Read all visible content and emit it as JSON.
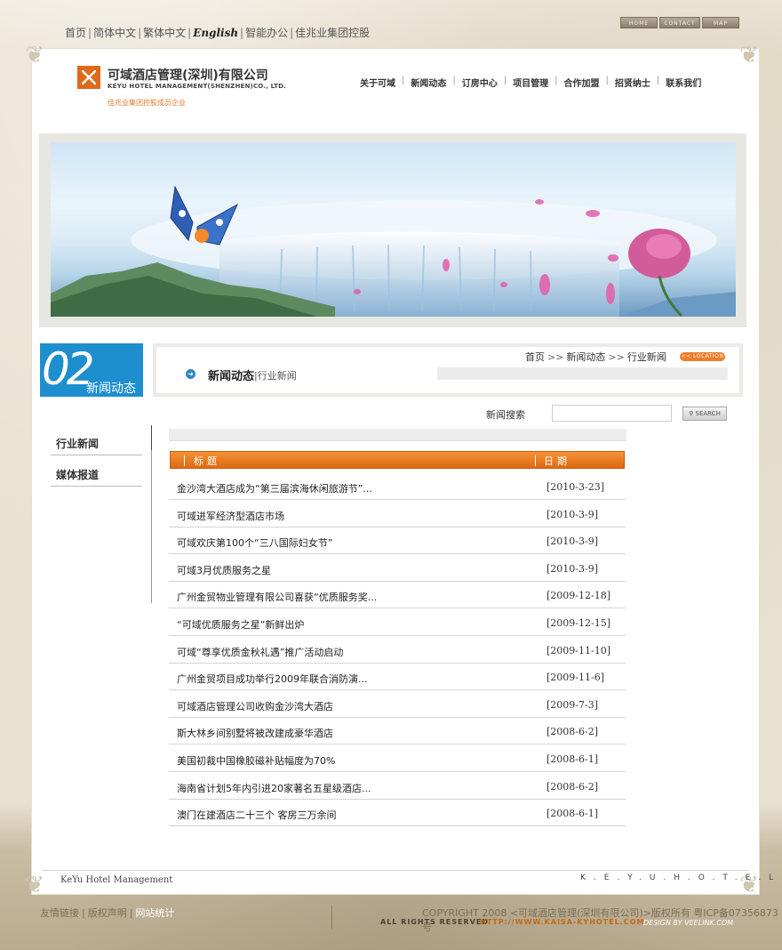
{
  "top_links": {
    "home": "首页",
    "simplified": "简体中文",
    "traditional": "繁体中文",
    "english": "English",
    "office": "智能办公",
    "group": "佳兆业集团控股"
  },
  "top_buttons": {
    "home": "HOME",
    "contact": "CONTACT",
    "map": "MAP"
  },
  "logo": {
    "cn": "可域酒店管理(深圳)有限公司",
    "en": "KEYU HOTEL MANAGEMENT(SHENZHEN)CO., LTD.",
    "sub": "佳兆业集团控股成员企业"
  },
  "nav": [
    "关于可域",
    "新闻动态",
    "订房中心",
    "项目管理",
    "合作加盟",
    "招贤纳士",
    "联系我们"
  ],
  "section": {
    "badge_num": "02",
    "badge_text": "新闻动态",
    "title": "新闻动态",
    "subtitle": "行业新闻",
    "location_label": "<< LOCATION"
  },
  "breadcrumb": {
    "home": "首页",
    "sep": ">>",
    "section": "新闻动态",
    "current": "行业新闻"
  },
  "search": {
    "label": "新闻搜索",
    "value": "",
    "button": "SEARCH"
  },
  "sidebar": {
    "items": [
      "行业新闻",
      "媒体报道"
    ]
  },
  "list": {
    "col_title": "标题",
    "col_date": "日期",
    "rows": [
      {
        "title": "金沙湾大酒店成为“第三届滨海休闲旅游节”...",
        "date": "[2010-3-23]"
      },
      {
        "title": "可域进军经济型酒店市场",
        "date": "[2010-3-9]"
      },
      {
        "title": "可域欢庆第100个“三八国际妇女节”",
        "date": "[2010-3-9]"
      },
      {
        "title": "可域3月优质服务之星",
        "date": "[2010-3-9]"
      },
      {
        "title": "广州金贸物业管理有限公司喜获“优质服务奖...",
        "date": "[2009-12-18]"
      },
      {
        "title": "“可域优质服务之星”新鲜出炉",
        "date": "[2009-12-15]"
      },
      {
        "title": "可域“尊享优质金秋礼遇”推广活动启动",
        "date": "[2009-11-10]"
      },
      {
        "title": "广州金贸项目成功举行2009年联合消防演...",
        "date": "[2009-11-6]"
      },
      {
        "title": "可域酒店管理公司收购金沙湾大酒店",
        "date": "[2009-7-3]"
      },
      {
        "title": "斯大林乡间别墅将被改建成豪华酒店",
        "date": "[2008-6-2]"
      },
      {
        "title": "美国初裁中国橡胶磁补贴幅度为70%",
        "date": "[2008-6-1]"
      },
      {
        "title": "海南省计划5年内引进20家著名五星级酒店...",
        "date": "[2008-6-2]"
      },
      {
        "title": "澳门在建酒店二十三个 客房三万余间",
        "date": "[2008-6-1]"
      }
    ]
  },
  "footer": {
    "brand": "KeYu Hotel Management",
    "brand2": "K.E.Y.U.H.O.T.E.L",
    "link_friends": "友情链接",
    "link_copyright": "版权声明",
    "link_stats": "网站统计",
    "copyright": "COPYRIGHT 2008 <可域酒店管理(深圳有限公司)>版权所有 粤ICP备07356873号",
    "rights": "ALL RIGHTS RESERVED",
    "url": "HTTP://WWW.KAISA-KYHOTEL.COM",
    "design": "DESIGN BY VEELINK.COM"
  },
  "colors": {
    "accent": "#e06a19",
    "blue": "#1d8fcf"
  }
}
